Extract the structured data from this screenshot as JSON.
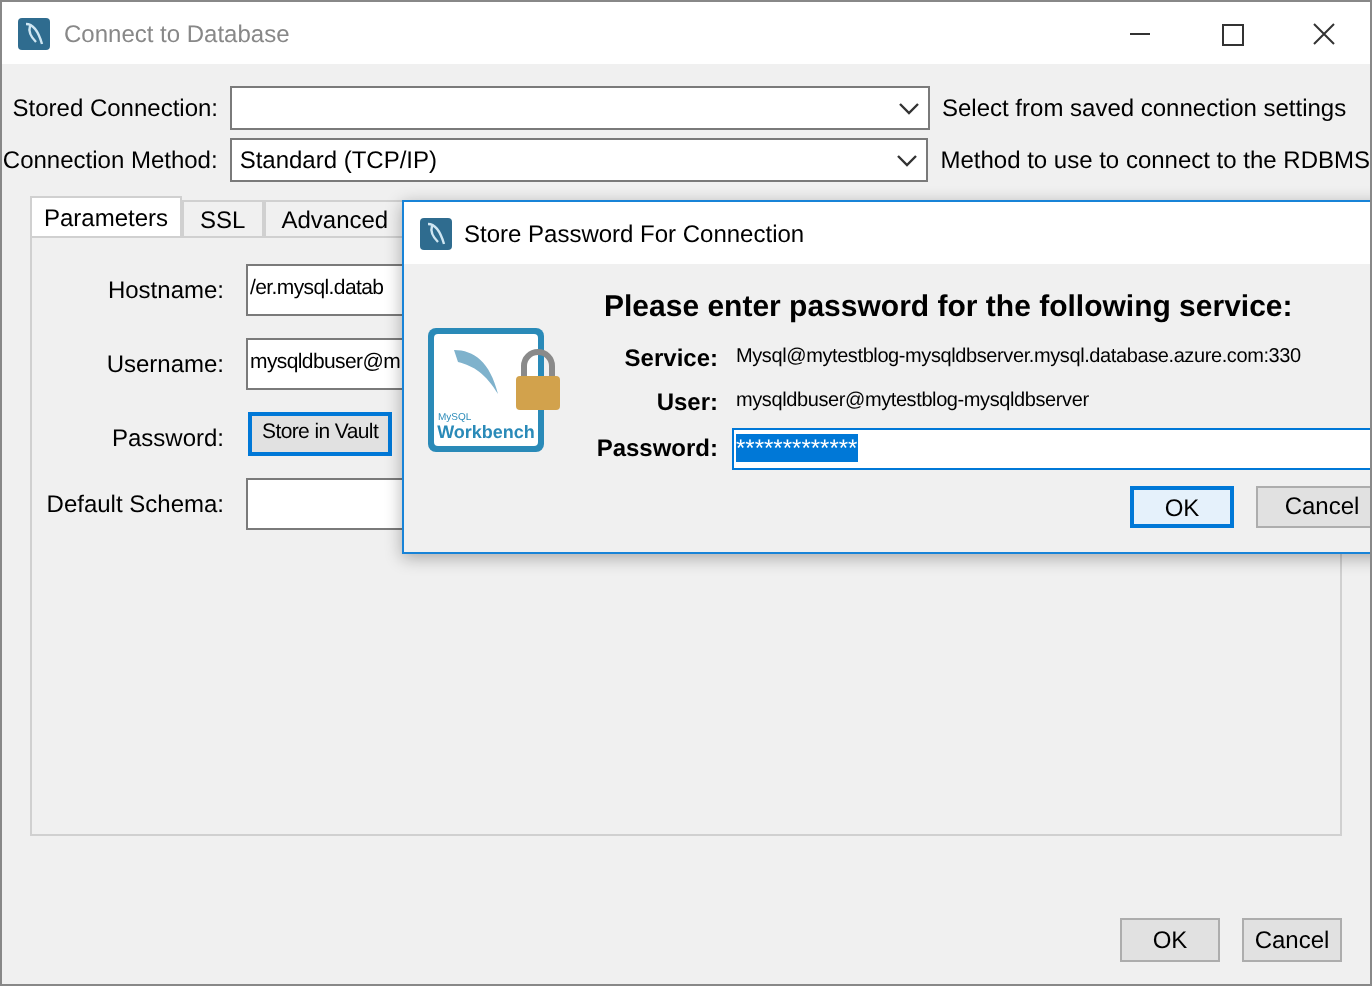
{
  "window": {
    "title": "Connect to Database"
  },
  "form": [
    {
      "label": "Stored Connection:",
      "hint": "Select from saved connection settings"
    },
    {
      "label": "Connection Method:",
      "value": "Standard (TCP/IP)",
      "hint": "Method to use to connect to the RDBMS"
    }
  ],
  "tabs": [
    {
      "label": "Parameters",
      "selected": true
    },
    {
      "label": "SSL",
      "selected": false
    },
    {
      "label": "Advanced",
      "selected": false
    }
  ],
  "parameters": [
    {
      "kind": "field",
      "label": "Hostname:",
      "value": "/er.mysql.datab"
    },
    {
      "kind": "field",
      "label": "Username:",
      "value": "mysqldbuser@m"
    },
    {
      "kind": "button",
      "label": "Password:",
      "value": "Store in Vault"
    },
    {
      "kind": "field",
      "label": "Default Schema:"
    }
  ],
  "buttons": [
    "OK",
    "Cancel"
  ],
  "dialog": {
    "title": "Store Password For Connection",
    "logo_brand": "MySQL",
    "logo_text": "Workbench",
    "heading": "Please enter password for the following service:",
    "rows": [
      {
        "label": "Service:",
        "value": "Mysql@mytestblog-mysqldbserver.mysql.database.azure.com:330"
      },
      {
        "label": "User:",
        "value": "mysqldbuser@mytestblog-mysqldbserver"
      }
    ],
    "password": {
      "label": "Password:",
      "value": "*************"
    },
    "buttons": [
      "OK",
      "Cancel"
    ]
  }
}
